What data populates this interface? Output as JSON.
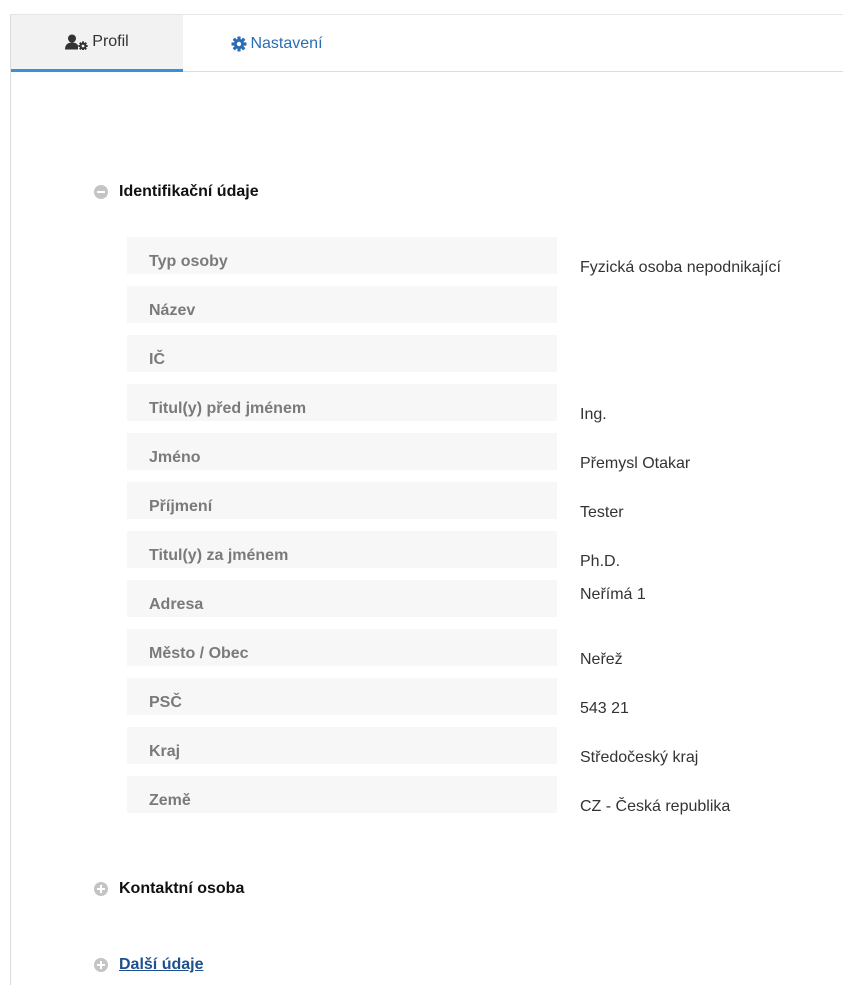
{
  "tabs": {
    "profil_label": "Profil",
    "nastaveni_label": "Nastavení"
  },
  "sections": {
    "identifikacni": {
      "title": "Identifikační údaje",
      "rows": [
        {
          "label": "Typ osoby",
          "value": "Fyzická osoba nepodnikající"
        },
        {
          "label": "Název",
          "value": ""
        },
        {
          "label": "IČ",
          "value": ""
        },
        {
          "label": "Titul(y) před jménem",
          "value": "Ing."
        },
        {
          "label": "Jméno",
          "value": "Přemysl Otakar"
        },
        {
          "label": "Příjmení",
          "value": "Tester"
        },
        {
          "label": "Titul(y) za jménem",
          "value": "Ph.D."
        },
        {
          "label": "Adresa",
          "value": "Neřímá 1"
        },
        {
          "label": "Město / Obec",
          "value": "Neřež"
        },
        {
          "label": "PSČ",
          "value": "543 21"
        },
        {
          "label": "Kraj",
          "value": "Středočeský kraj"
        },
        {
          "label": "Země",
          "value": "CZ - Česká republika"
        }
      ]
    },
    "kontaktni": {
      "title": "Kontaktní osoba"
    },
    "dalsi": {
      "title": "Další údaje"
    }
  },
  "colors": {
    "accent": "#3a8fd6",
    "link": "#2a6db5",
    "label_bg": "#f7f7f7",
    "label_text": "#7a7a7a",
    "toggle": "#c4c4c4"
  },
  "icons": {
    "profil": "user-cog-icon",
    "nastaveni": "gear-icon",
    "collapse": "minus-circle-icon",
    "expand": "plus-circle-icon"
  }
}
